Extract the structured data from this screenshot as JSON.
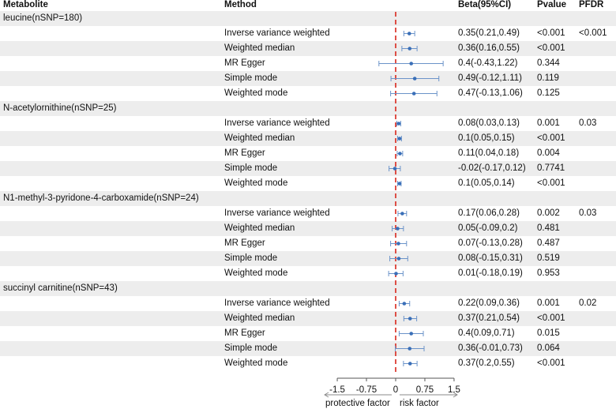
{
  "headers": {
    "metabolite": "Metabolite",
    "method": "Method",
    "beta": "Beta(95%CI)",
    "pvalue": "Pvalue",
    "pfdr": "PFDR"
  },
  "x_axis": {
    "ticks": [
      -1.5,
      -0.75,
      0,
      0.75,
      1.5
    ],
    "tick_labels": [
      "-1.5",
      "-0.75",
      "0",
      "0.75",
      "1.5"
    ],
    "left_label": "protective factor",
    "right_label": "risk factor"
  },
  "colors": {
    "point": "#3a6fb8",
    "ci_line": "#6b93c9",
    "reference_line": "#d9261c",
    "row_shade": "#ededed"
  },
  "chart_data": {
    "type": "forest",
    "xlim": [
      -1.5,
      1.5
    ],
    "reference": 0,
    "groups": [
      {
        "metabolite": "leucine(nSNP=180)",
        "rows": [
          {
            "method": "Inverse variance weighted",
            "beta": 0.35,
            "lo": 0.21,
            "hi": 0.49,
            "beta_ci": "0.35(0.21,0.49)",
            "pvalue": "<0.001",
            "pfdr": "<0.001"
          },
          {
            "method": "Weighted median",
            "beta": 0.36,
            "lo": 0.16,
            "hi": 0.55,
            "beta_ci": "0.36(0.16,0.55)",
            "pvalue": "<0.001",
            "pfdr": ""
          },
          {
            "method": "MR Egger",
            "beta": 0.4,
            "lo": -0.43,
            "hi": 1.22,
            "beta_ci": "0.4(-0.43,1.22)",
            "pvalue": "0.344",
            "pfdr": ""
          },
          {
            "method": "Simple mode",
            "beta": 0.49,
            "lo": -0.12,
            "hi": 1.11,
            "beta_ci": "0.49(-0.12,1.11)",
            "pvalue": "0.119",
            "pfdr": ""
          },
          {
            "method": "Weighted mode",
            "beta": 0.47,
            "lo": -0.13,
            "hi": 1.06,
            "beta_ci": "0.47(-0.13,1.06)",
            "pvalue": "0.125",
            "pfdr": ""
          }
        ]
      },
      {
        "metabolite": "N-acetylornithine(nSNP=25)",
        "rows": [
          {
            "method": "Inverse variance weighted",
            "beta": 0.08,
            "lo": 0.03,
            "hi": 0.13,
            "beta_ci": "0.08(0.03,0.13)",
            "pvalue": "0.001",
            "pfdr": "0.03"
          },
          {
            "method": "Weighted median",
            "beta": 0.1,
            "lo": 0.05,
            "hi": 0.15,
            "beta_ci": "0.1(0.05,0.15)",
            "pvalue": "<0.001",
            "pfdr": ""
          },
          {
            "method": "MR Egger",
            "beta": 0.11,
            "lo": 0.04,
            "hi": 0.18,
            "beta_ci": "0.11(0.04,0.18)",
            "pvalue": "0.004",
            "pfdr": ""
          },
          {
            "method": "Simple mode",
            "beta": -0.02,
            "lo": -0.17,
            "hi": 0.12,
            "beta_ci": "-0.02(-0.17,0.12)",
            "pvalue": "0.7741",
            "pfdr": ""
          },
          {
            "method": "Weighted mode",
            "beta": 0.1,
            "lo": 0.05,
            "hi": 0.14,
            "beta_ci": "0.1(0.05,0.14)",
            "pvalue": "<0.001",
            "pfdr": ""
          }
        ]
      },
      {
        "metabolite": "N1-methyl-3-pyridone-4-carboxamide(nSNP=24)",
        "rows": [
          {
            "method": "Inverse variance weighted",
            "beta": 0.17,
            "lo": 0.06,
            "hi": 0.28,
            "beta_ci": "0.17(0.06,0.28)",
            "pvalue": "0.002",
            "pfdr": "0.03"
          },
          {
            "method": "Weighted median",
            "beta": 0.05,
            "lo": -0.09,
            "hi": 0.2,
            "beta_ci": "0.05(-0.09,0.2)",
            "pvalue": "0.481",
            "pfdr": ""
          },
          {
            "method": "MR Egger",
            "beta": 0.07,
            "lo": -0.13,
            "hi": 0.28,
            "beta_ci": "0.07(-0.13,0.28)",
            "pvalue": "0.487",
            "pfdr": ""
          },
          {
            "method": "Simple mode",
            "beta": 0.08,
            "lo": -0.15,
            "hi": 0.31,
            "beta_ci": "0.08(-0.15,0.31)",
            "pvalue": "0.519",
            "pfdr": ""
          },
          {
            "method": "Weighted mode",
            "beta": 0.01,
            "lo": -0.18,
            "hi": 0.19,
            "beta_ci": "0.01(-0.18,0.19)",
            "pvalue": "0.953",
            "pfdr": ""
          }
        ]
      },
      {
        "metabolite": "succinyl carnitine(nSNP=43)",
        "rows": [
          {
            "method": "Inverse variance weighted",
            "beta": 0.22,
            "lo": 0.09,
            "hi": 0.36,
            "beta_ci": "0.22(0.09,0.36)",
            "pvalue": "0.001",
            "pfdr": "0.02"
          },
          {
            "method": "Weighted median",
            "beta": 0.37,
            "lo": 0.21,
            "hi": 0.54,
            "beta_ci": "0.37(0.21,0.54)",
            "pvalue": "<0.001",
            "pfdr": ""
          },
          {
            "method": "MR Egger",
            "beta": 0.4,
            "lo": 0.09,
            "hi": 0.71,
            "beta_ci": "0.4(0.09,0.71)",
            "pvalue": "0.015",
            "pfdr": ""
          },
          {
            "method": "Simple mode",
            "beta": 0.36,
            "lo": -0.01,
            "hi": 0.73,
            "beta_ci": "0.36(-0.01,0.73)",
            "pvalue": "0.064",
            "pfdr": ""
          },
          {
            "method": "Weighted mode",
            "beta": 0.37,
            "lo": 0.2,
            "hi": 0.55,
            "beta_ci": "0.37(0.2,0.55)",
            "pvalue": "<0.001",
            "pfdr": ""
          }
        ]
      }
    ]
  }
}
